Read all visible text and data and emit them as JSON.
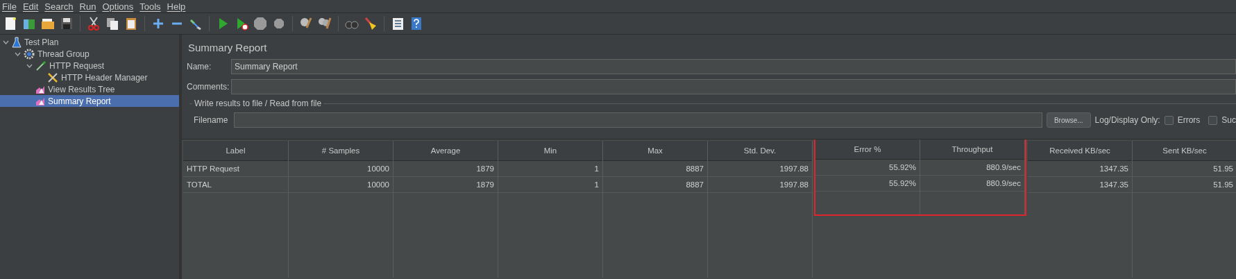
{
  "menu": [
    "File",
    "Edit",
    "Search",
    "Run",
    "Options",
    "Tools",
    "Help"
  ],
  "tree": [
    {
      "label": "Test Plan",
      "kind": "plan",
      "expanded": true,
      "selected": false,
      "children": [
        {
          "label": "Thread Group",
          "kind": "group",
          "expanded": true,
          "selected": false,
          "children": [
            {
              "label": "HTTP Request",
              "kind": "sampler",
              "expanded": true,
              "selected": false,
              "children": [
                {
                  "label": "HTTP Header Manager",
                  "kind": "config",
                  "selected": false
                }
              ]
            },
            {
              "label": "View Results Tree",
              "kind": "listener",
              "selected": false
            },
            {
              "label": "Summary Report",
              "kind": "listener",
              "selected": true
            }
          ]
        }
      ]
    }
  ],
  "panel": {
    "title": "Summary Report",
    "name": {
      "label": "Name:",
      "value": "Summary Report"
    },
    "comments": {
      "label": "Comments:"
    },
    "file_group": {
      "title": "Write results to file / Read from file",
      "filename_label": "Filename",
      "browse": "Browse...",
      "log_label": "Log/Display Only:",
      "checkboxes": [
        {
          "label": "Errors",
          "checked": false
        },
        {
          "label": "Suc",
          "checked": false
        }
      ]
    }
  },
  "table": {
    "columns": [
      {
        "label": "Label",
        "highlighted": false
      },
      {
        "label": "# Samples",
        "highlighted": false
      },
      {
        "label": "Average",
        "highlighted": false
      },
      {
        "label": "Min",
        "highlighted": false
      },
      {
        "label": "Max",
        "highlighted": false
      },
      {
        "label": "Std. Dev.",
        "highlighted": false
      },
      {
        "label": "Error %",
        "highlighted": true
      },
      {
        "label": "Throughput",
        "highlighted": true
      },
      {
        "label": "Received KB/sec",
        "highlighted": false
      },
      {
        "label": "Sent KB/sec",
        "highlighted": false
      }
    ],
    "rows": [
      [
        "HTTP Request",
        "10000",
        "1879",
        "1",
        "8887",
        "1997.88",
        "55.92%",
        "880.9/sec",
        "1347.35",
        "51.95"
      ],
      [
        "TOTAL",
        "10000",
        "1879",
        "1",
        "8887",
        "1997.88",
        "55.92%",
        "880.9/sec",
        "1347.35",
        "51.95"
      ]
    ]
  }
}
